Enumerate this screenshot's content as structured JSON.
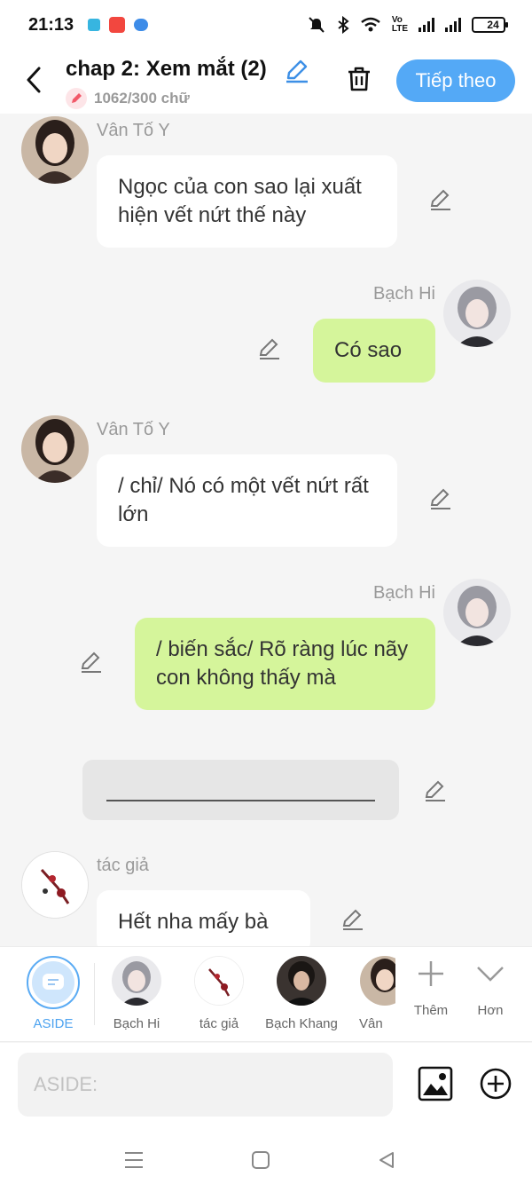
{
  "status_bar": {
    "time": "21:13",
    "battery": "24"
  },
  "header": {
    "title": "chap 2: Xem mắt (2)",
    "word_count": "1062/300 chữ",
    "next_button": "Tiếp theo"
  },
  "messages": [
    {
      "speaker": "Vân Tố Y",
      "text": "Ngọc của con sao lại xuất hiện vết nứt thế này",
      "side": "left"
    },
    {
      "speaker": "Bạch Hi",
      "text": "Có sao",
      "side": "right"
    },
    {
      "speaker": "Vân Tố Y",
      "text": "/ chỉ/ Nó có một vết nứt rất lớn",
      "side": "left"
    },
    {
      "speaker": "Bạch Hi",
      "text": "/ biến sắc/ Rõ ràng lúc nãy con không thấy mà",
      "side": "right"
    },
    {
      "speaker": "tác giả",
      "text": "Hết nha mấy bà",
      "side": "left"
    }
  ],
  "characters": [
    {
      "label": "ASIDE"
    },
    {
      "label": "Bạch Hi"
    },
    {
      "label": "tác giả"
    },
    {
      "label": "Bạch Khang"
    },
    {
      "label": "Vân"
    }
  ],
  "tools": {
    "add": "Thêm",
    "more": "Hơn"
  },
  "input": {
    "placeholder": "ASIDE:"
  },
  "colors": {
    "accent": "#54a9f6",
    "right_bubble": "#d5f59b",
    "left_bubble": "#ffffff"
  }
}
